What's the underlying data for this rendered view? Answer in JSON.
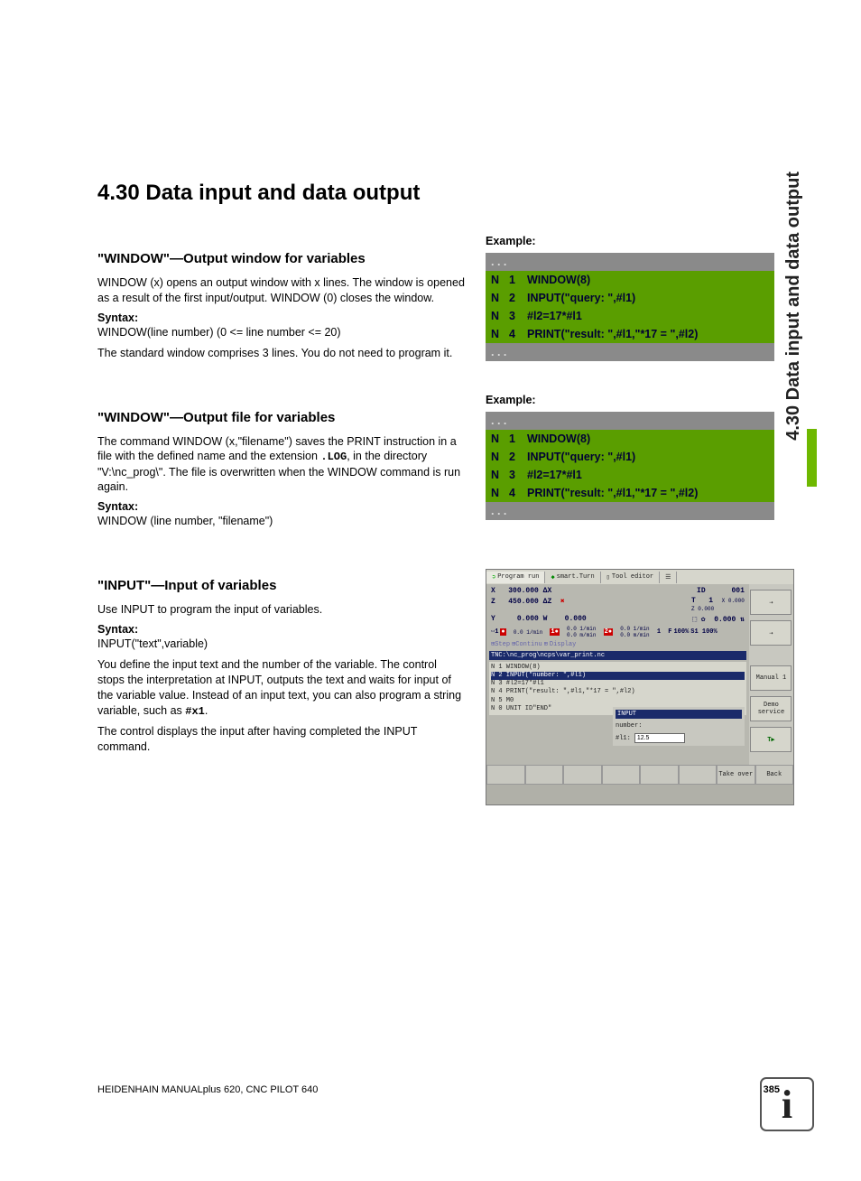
{
  "heading": "4.30 Data input and data output",
  "side_tab": "4.30 Data input and data output",
  "section1": {
    "title": "\"WINDOW\"—Output window for variables",
    "p1": "WINDOW (x) opens an output window with x lines. The window is opened as a result of the first input/output. WINDOW (0) closes the window.",
    "syntax_label": "Syntax:",
    "syntax_line": "WINDOW(line number) (0 <= line number <= 20)",
    "p2": "The standard window comprises 3 lines. You do not need to program it."
  },
  "section2": {
    "title": "\"WINDOW\"—Output file for variables",
    "p1a": "The command WINDOW (x,\"filename\") saves the PRINT instruction in a file with the defined name and the extension ",
    "p1_code": ".LOG",
    "p1b": ", in the directory \"V:\\nc_prog\\\". The file is overwritten when the WINDOW command is run again.",
    "syntax_label": "Syntax:",
    "syntax_line": "WINDOW (line number, \"filename\")"
  },
  "section3": {
    "title": "\"INPUT\"—Input of variables",
    "p1": "Use INPUT to program the input of variables.",
    "syntax_label": "Syntax:",
    "syntax_line": "INPUT(\"text\",variable)",
    "p2a": "You define the input text and the number of the variable. The control stops the interpretation at INPUT, outputs the text and waits for input of the variable value. Instead of an input text, you can also program a string variable, such as ",
    "p2_code": "#x1",
    "p2b": ".",
    "p3": "The control displays the input after having completed the INPUT command."
  },
  "example_label": "Example:",
  "code": {
    "dots": ". . .",
    "n": "N",
    "l1_num": "1",
    "l1": "WINDOW(8)",
    "l2_num": "2",
    "l2": "INPUT(\"query: \",#l1)",
    "l3_num": "3",
    "l3": "#l2=17*#l1",
    "l4_num": "4",
    "l4": "PRINT(\"result: \",#l1,\"*17 = \",#l2)"
  },
  "screenshot": {
    "tab1": "Program run",
    "tab2": "smart.Turn",
    "tab3": "Tool editor",
    "x": "X",
    "xv": "300.000",
    "dx": "ΔX",
    "z": "Z",
    "zv": "450.000",
    "dz": "ΔZ",
    "y": "Y",
    "yv": "0.000",
    "w": "W",
    "wv": "0.000",
    "id": "ID",
    "idv": "001",
    "t": "T",
    "tv": "1",
    "f": "F",
    "s": "S",
    "display_row": "Display",
    "path": "TNC:\\nc_prog\\ncps\\var_print.nc",
    "prog": [
      "N   1 WINDOW(8)",
      "N   2 INPUT(\"number: \",#l1)",
      "N   3 #l2=17*#l1",
      "N   4 PRINT(\"result: \",#l1,\"*17 = \",#l2)",
      "N   5 M0",
      "",
      "N   0 UNIT ID\"END\""
    ],
    "input_hdr": "INPUT",
    "input_lbl": "number:",
    "input_var": "#l1:",
    "input_val": "12.5",
    "btn_manual": "Manual 1",
    "btn_service": "Demo\nservice",
    "btn_play": "T▶",
    "bottom_take": "Take over",
    "bottom_back": "Back",
    "pct100a": "100%",
    "pct100b": "S1 100%",
    "zero": "0.000"
  },
  "footer_left": "HEIDENHAIN MANUALplus 620, CNC PILOT 640",
  "footer_page": "385"
}
